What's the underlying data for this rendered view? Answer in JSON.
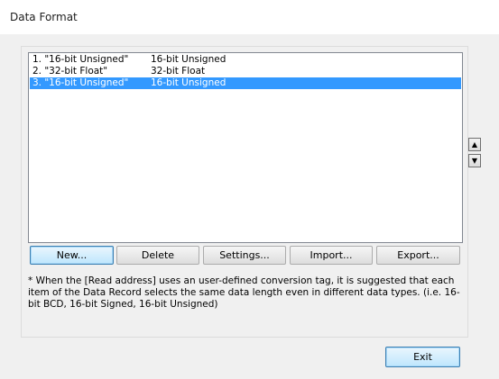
{
  "window": {
    "title": "Data Format"
  },
  "list": {
    "rows": [
      {
        "name": "1. \"16-bit Unsigned\"",
        "type": "16-bit Unsigned",
        "selected": false
      },
      {
        "name": "2. \"32-bit Float\"",
        "type": "32-bit Float",
        "selected": false
      },
      {
        "name": "3. \"16-bit Unsigned\"",
        "type": "16-bit Unsigned",
        "selected": true
      }
    ]
  },
  "scroll": {
    "up_label": "▲",
    "down_label": "▼"
  },
  "buttons": {
    "new": "New...",
    "delete": "Delete",
    "settings": "Settings...",
    "import": "Import...",
    "export": "Export...",
    "exit": "Exit"
  },
  "note": {
    "text": "* When the [Read address] uses an user-defined conversion tag, it is suggested that each item of the Data Record selects the same data length even in different data types. (i.e. 16-bit BCD, 16-bit Signed, 16-bit Unsigned)"
  },
  "colors": {
    "selection": "#3399ff",
    "focus_border": "#3c7fb1"
  }
}
